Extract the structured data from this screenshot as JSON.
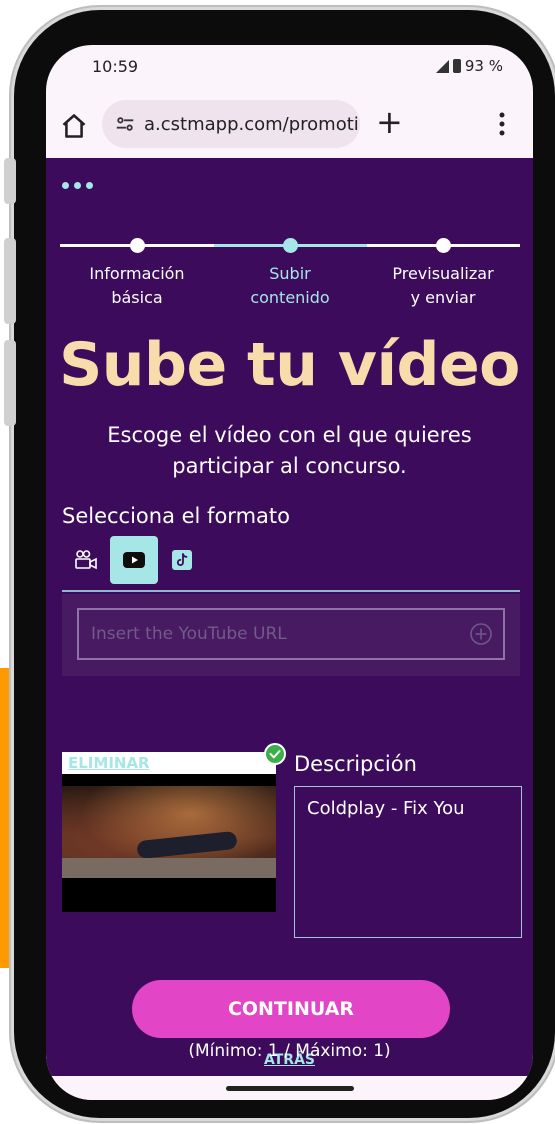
{
  "status_bar": {
    "time": "10:59",
    "battery": "93 %"
  },
  "browser": {
    "url": "a.cstmapp.com/promoti"
  },
  "stepper": {
    "steps": [
      {
        "label_line1": "Información",
        "label_line2": "básica"
      },
      {
        "label_line1": "Subir",
        "label_line2": "contenido"
      },
      {
        "label_line1": "Previsualizar",
        "label_line2": "y enviar"
      }
    ],
    "active_index": 1
  },
  "page": {
    "title": "Sube tu vídeo",
    "subtitle": "Escoge el vídeo con el que quieres participar al concurso."
  },
  "format": {
    "label": "Selecciona el formato",
    "options": [
      "video-camera-icon",
      "youtube-icon",
      "tiktok-icon"
    ],
    "selected": "youtube-icon"
  },
  "url_input": {
    "placeholder": "Insert the YouTube URL",
    "value": ""
  },
  "video_card": {
    "remove_label": "ELIMINAR"
  },
  "description": {
    "label": "Descripción",
    "value": "Coldplay - Fix You"
  },
  "actions": {
    "continue_label": "CONTINUAR",
    "back_label": "ATRÁS"
  },
  "limits": {
    "text": "(Mínimo: 1 / Máximo: 1)"
  },
  "colors": {
    "app_background": "#3d0b5b",
    "accent": "#a7e6e6",
    "title": "#f6ddab",
    "button": "#e245c6"
  }
}
